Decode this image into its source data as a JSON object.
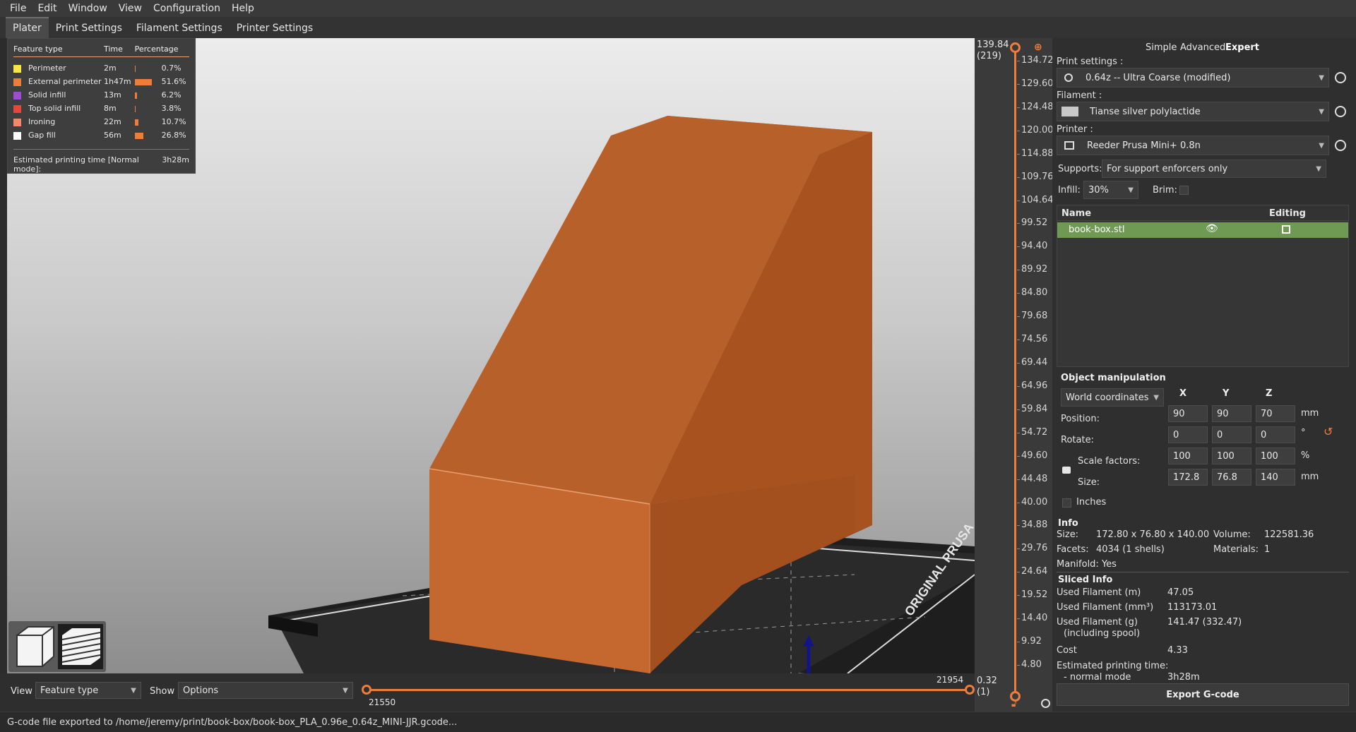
{
  "menu": [
    "File",
    "Edit",
    "Window",
    "View",
    "Configuration",
    "Help"
  ],
  "tabs": [
    "Plater",
    "Print Settings",
    "Filament Settings",
    "Printer Settings"
  ],
  "legend": {
    "headers": {
      "feature": "Feature type",
      "time": "Time",
      "pct": "Percentage"
    },
    "rows": [
      {
        "name": "Perimeter",
        "time": "2m",
        "pct": "0.7%",
        "frac": 0.007,
        "color": "#f7e646"
      },
      {
        "name": "External perimeter",
        "time": "1h47m",
        "pct": "51.6%",
        "frac": 0.516,
        "color": "#ee7d3a"
      },
      {
        "name": "Solid infill",
        "time": "13m",
        "pct": "6.2%",
        "frac": 0.062,
        "color": "#9b4fd0"
      },
      {
        "name": "Top solid infill",
        "time": "8m",
        "pct": "3.8%",
        "frac": 0.038,
        "color": "#e8463c"
      },
      {
        "name": "Ironing",
        "time": "22m",
        "pct": "10.7%",
        "frac": 0.107,
        "color": "#f08a6a"
      },
      {
        "name": "Gap fill",
        "time": "56m",
        "pct": "26.8%",
        "frac": 0.268,
        "color": "#ffffff"
      }
    ],
    "estimate_label": "Estimated printing time [Normal mode]:",
    "estimate_value": "3h28m"
  },
  "bottom": {
    "view_label": "View",
    "view_value": "Feature type",
    "show_label": "Show",
    "show_value": "Options",
    "hslider_top": "21954",
    "hslider_bottom": "21550"
  },
  "status": "G-code file exported to /home/jeremy/print/book-box/book-box_PLA_0.96e_0.64z_MINI-JJR.gcode...",
  "vslider": {
    "top_value": "139.84",
    "top_layer": "(219)",
    "bottom_value": "0.32",
    "bottom_layer": "(1)",
    "ticks": [
      "134.72",
      "129.60",
      "124.48",
      "120.00",
      "114.88",
      "109.76",
      "104.64",
      "99.52",
      "94.40",
      "89.92",
      "84.80",
      "79.68",
      "74.56",
      "69.44",
      "64.96",
      "59.84",
      "54.72",
      "49.60",
      "44.48",
      "40.00",
      "34.88",
      "29.76",
      "24.64",
      "19.52",
      "14.40",
      "9.92",
      "4.80"
    ]
  },
  "panel": {
    "modes": [
      "Simple",
      "Advanced",
      "Expert"
    ],
    "print_settings_label": "Print settings :",
    "print_settings_value": "0.64z -- Ultra Coarse (modified)",
    "filament_label": "Filament :",
    "filament_value": "Tianse silver polylactide",
    "printer_label": "Printer :",
    "printer_value": "Reeder Prusa Mini+ 0.8n",
    "supports_label": "Supports:",
    "supports_value": "For support enforcers only",
    "infill_label": "Infill:",
    "infill_value": "30%",
    "brim_label": "Brim:",
    "list_name_header": "Name",
    "list_editing_header": "Editing",
    "object_name": "book-box.stl",
    "om_title": "Object manipulation",
    "coords_value": "World coordinates",
    "axes": [
      "X",
      "Y",
      "Z"
    ],
    "position_label": "Position:",
    "rotate_label": "Rotate:",
    "scale_label": "Scale factors:",
    "size_label": "Size:",
    "inches_label": "Inches",
    "position": [
      "90",
      "90",
      "70"
    ],
    "rotate": [
      "0",
      "0",
      "0"
    ],
    "scale": [
      "100",
      "100",
      "100"
    ],
    "size": [
      "172.8",
      "76.8",
      "140"
    ],
    "unit_mm": "mm",
    "unit_deg": "°",
    "unit_pct": "%",
    "info_title": "Info",
    "info_size_label": "Size:",
    "info_size_value": "172.80 x 76.80 x 140.00",
    "info_volume_label": "Volume:",
    "info_volume_value": "122581.36",
    "info_facets_label": "Facets:",
    "info_facets_value": "4034 (1 shells)",
    "info_materials_label": "Materials:",
    "info_materials_value": "1",
    "info_manifold": "Manifold: Yes",
    "sliced_title": "Sliced Info",
    "sliced": [
      {
        "label": "Used Filament (m)",
        "value": "47.05"
      },
      {
        "label": "Used Filament (mm³)",
        "value": "113173.01"
      },
      {
        "label": "Used Filament (g)",
        "value": "141.47 (332.47)"
      },
      {
        "label": "(including spool)",
        "value": ""
      },
      {
        "label": "Cost",
        "value": "4.33"
      },
      {
        "label": "Estimated printing time:",
        "value": ""
      },
      {
        "label": "- normal mode",
        "value": "3h28m"
      }
    ],
    "export_button": "Export G-code"
  },
  "colors": {
    "accent": "#ee7d3a",
    "object": "#b35a22",
    "selected_row": "#6f9a54"
  }
}
